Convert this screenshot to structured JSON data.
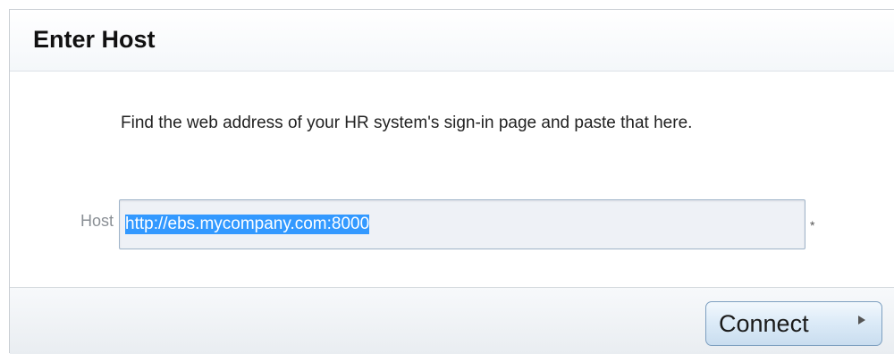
{
  "dialog": {
    "title": "Enter Host",
    "instructions": "Find the web address of your HR system's sign-in page and paste that here.",
    "host_label": "Host",
    "host_value": "http://ebs.mycompany.com:8000",
    "required_marker": "*",
    "connect_label": "Connect"
  }
}
